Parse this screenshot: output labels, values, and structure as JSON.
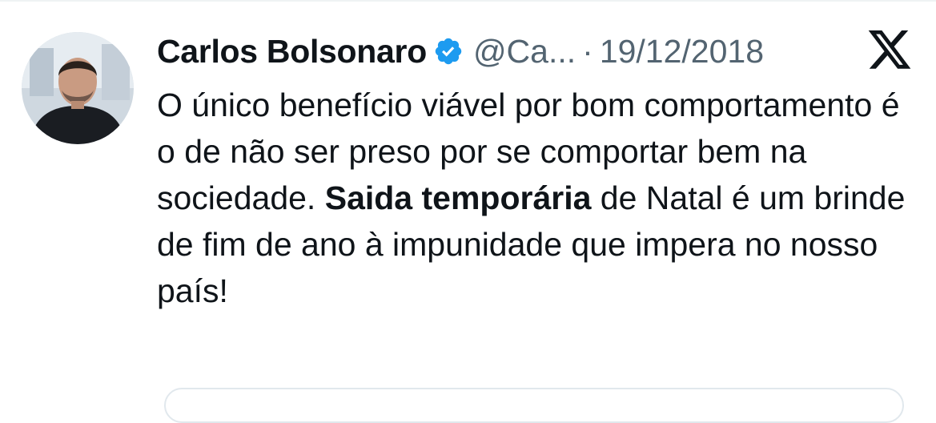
{
  "tweet": {
    "author_name": "Carlos Bolsonaro",
    "verified_icon": "verified-badge-icon",
    "handle": "@Ca...",
    "separator": "·",
    "date": "19/12/2018",
    "platform_icon": "x-logo-icon",
    "text_part_1": "O único benefício viável por bom comportamento é o de não ser preso por se comportar bem na sociedade. ",
    "text_bold": "Saida temporária",
    "text_part_2": " de Natal é um brinde de fim de ano à impunidade que impera no nosso país!"
  },
  "colors": {
    "text": "#0f1419",
    "secondary": "#536471",
    "verified": "#1d9bf0",
    "border": "#eff3f4"
  }
}
